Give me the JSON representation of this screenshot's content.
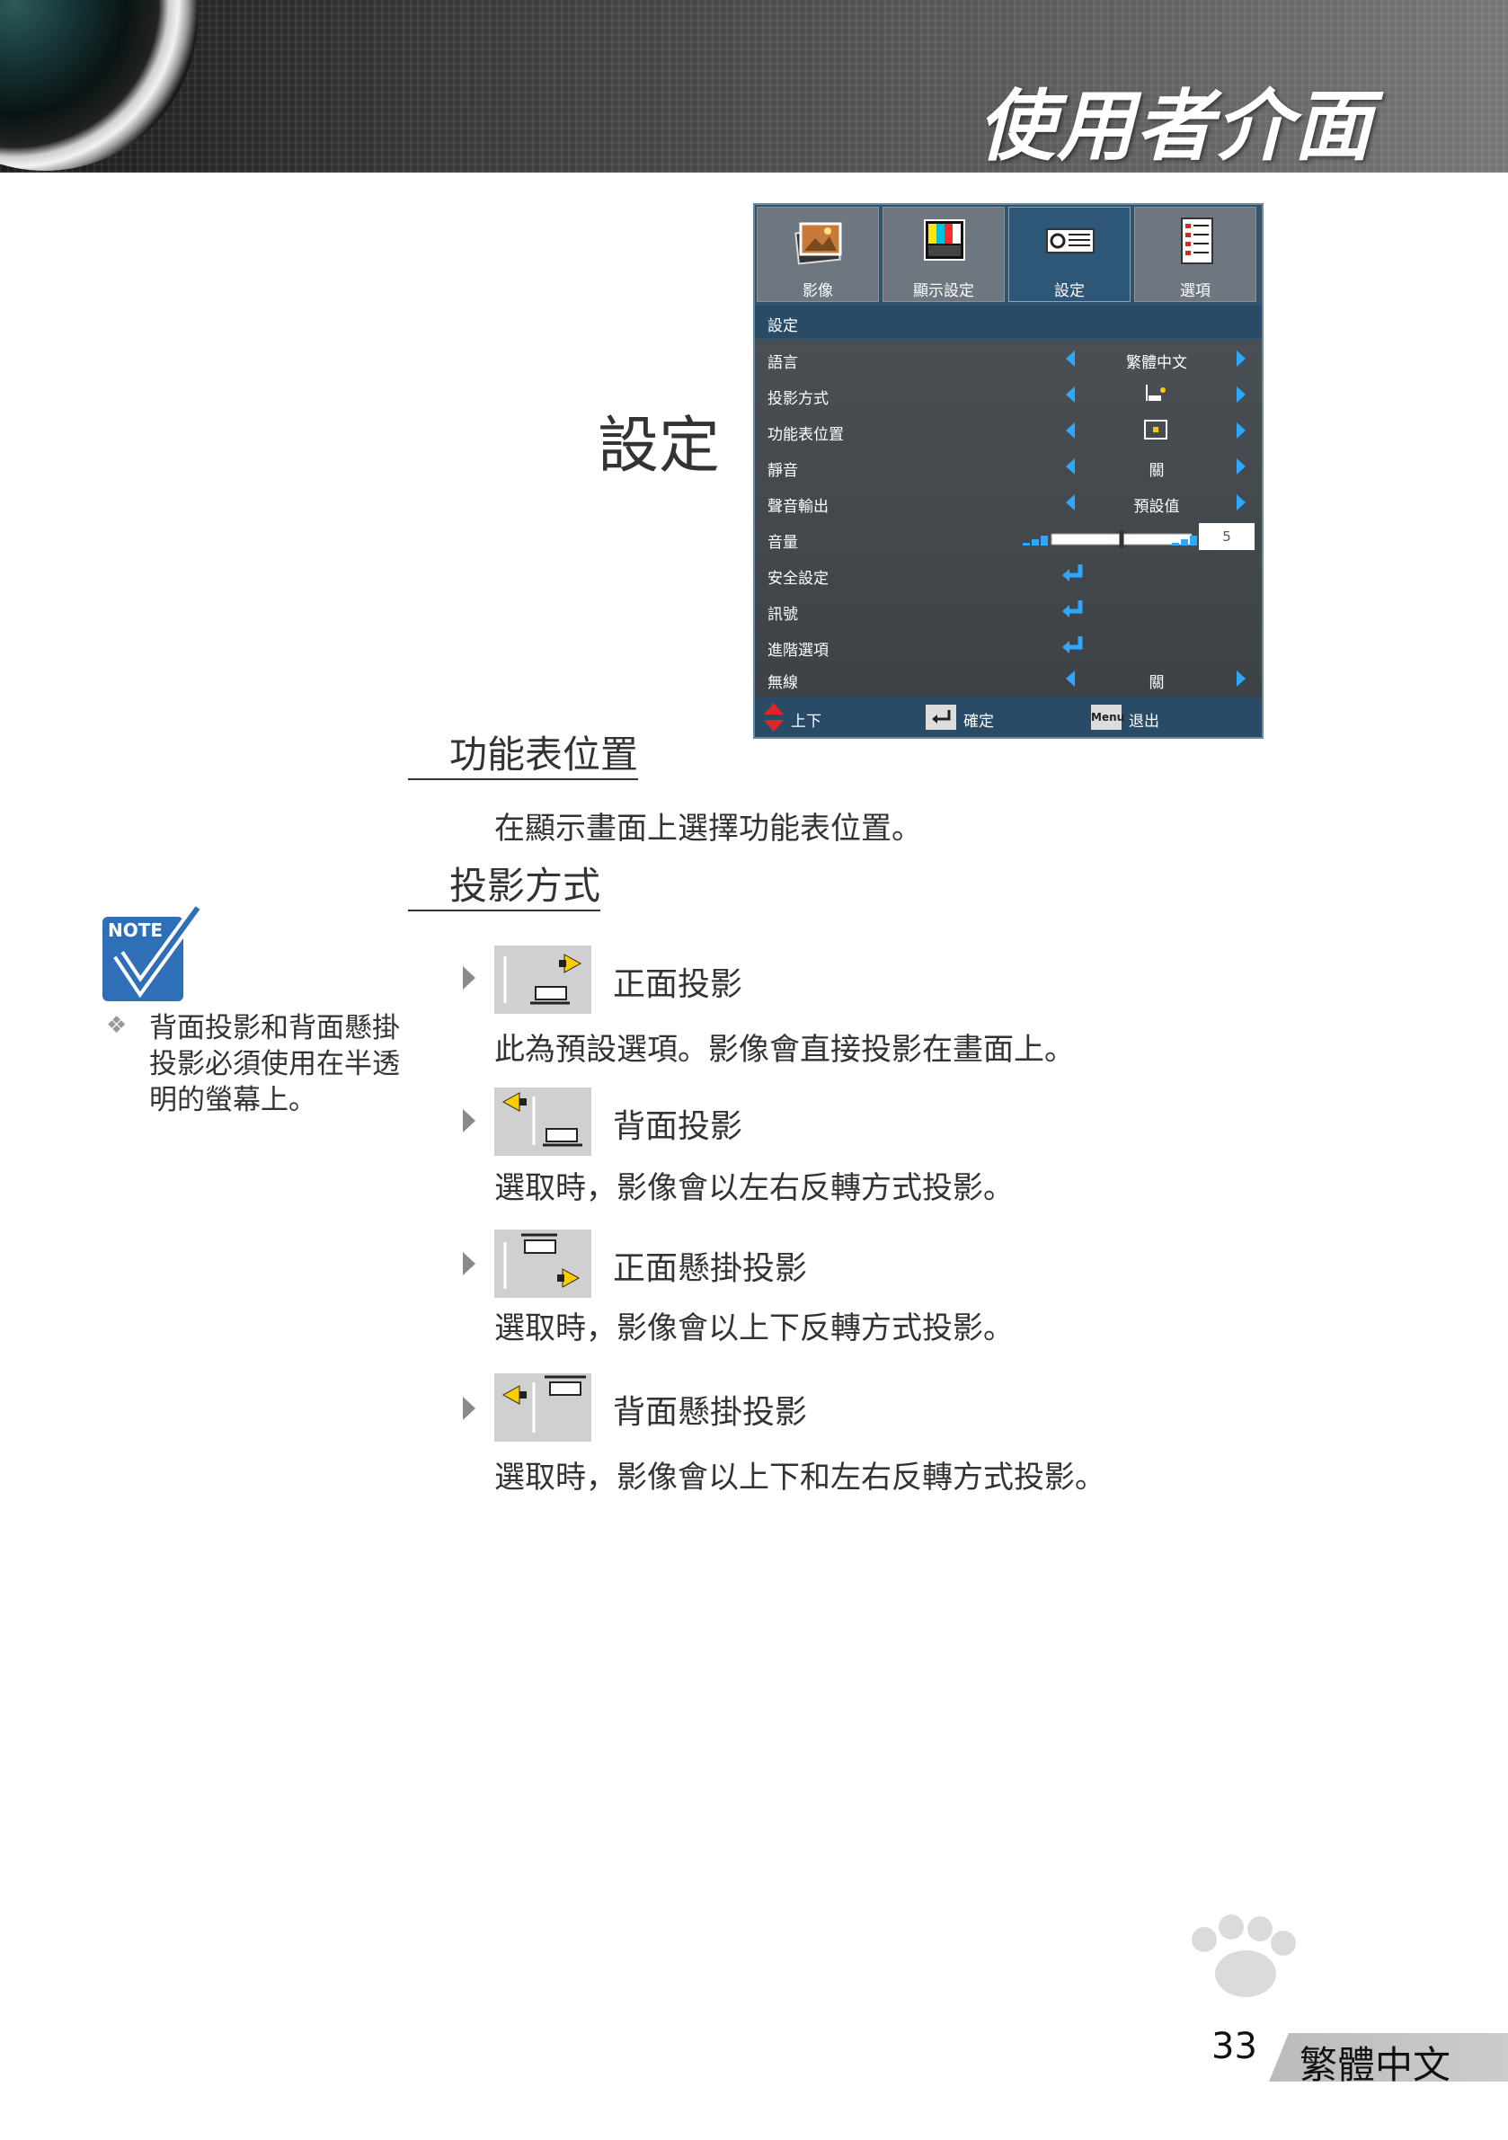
{
  "header": {
    "title": "使用者介面"
  },
  "section": {
    "heading": "設定"
  },
  "osd": {
    "tabs": [
      {
        "label": "影像",
        "icon": "image-icon"
      },
      {
        "label": "顯示設定",
        "icon": "display-settings-icon"
      },
      {
        "label": "設定",
        "icon": "projector-setup-icon"
      },
      {
        "label": "選項",
        "icon": "options-list-icon"
      }
    ],
    "active_tab": "設定",
    "title": "設定",
    "rows": [
      {
        "label": "語言",
        "value": "繁體中文"
      },
      {
        "label": "投影方式",
        "value_icon": "projection-mode-icon"
      },
      {
        "label": "功能表位置",
        "value_icon": "menu-position-icon"
      },
      {
        "label": "靜音",
        "value": "關"
      },
      {
        "label": "聲音輸出",
        "value": "預設值"
      },
      {
        "label": "音量",
        "volume": 5,
        "volume_text": "5"
      },
      {
        "label": "安全設定",
        "value_icon": "enter-icon"
      },
      {
        "label": "訊號",
        "value_icon": "enter-icon"
      },
      {
        "label": "進階選項",
        "value_icon": "enter-icon"
      },
      {
        "label": "無線",
        "value": "關"
      }
    ],
    "footer": {
      "updown": "上下",
      "enter": "確定",
      "menu_key": "Menu",
      "exit": "退出"
    },
    "colors": {
      "arrow": "#2ea8ff",
      "title_bar": "#2a4b66",
      "active_tab": "#2d5677"
    }
  },
  "menu_position": {
    "heading": "功能表位置",
    "description": "在顯示畫面上選擇功能表位置。"
  },
  "projection": {
    "heading": "投影方式",
    "options": [
      {
        "label": "正面投影",
        "description": "此為預設選項。影像會直接投影在畫面上。",
        "icon": "front-projection-icon"
      },
      {
        "label": "背面投影",
        "description": "選取時，影像會以左右反轉方式投影。",
        "icon": "rear-projection-icon"
      },
      {
        "label": "正面懸掛投影",
        "description": "選取時，影像會以上下反轉方式投影。",
        "icon": "front-ceiling-projection-icon"
      },
      {
        "label": "背面懸掛投影",
        "description": "選取時，影像會以上下和左右反轉方式投影。",
        "icon": "rear-ceiling-projection-icon"
      }
    ]
  },
  "note": {
    "icon_label": "NOTE",
    "bullet": "❖",
    "text": "背面投影和背面懸掛投影必須使用在半透明的螢幕上。"
  },
  "footer": {
    "page_number": "33",
    "language": "繁體中文"
  }
}
